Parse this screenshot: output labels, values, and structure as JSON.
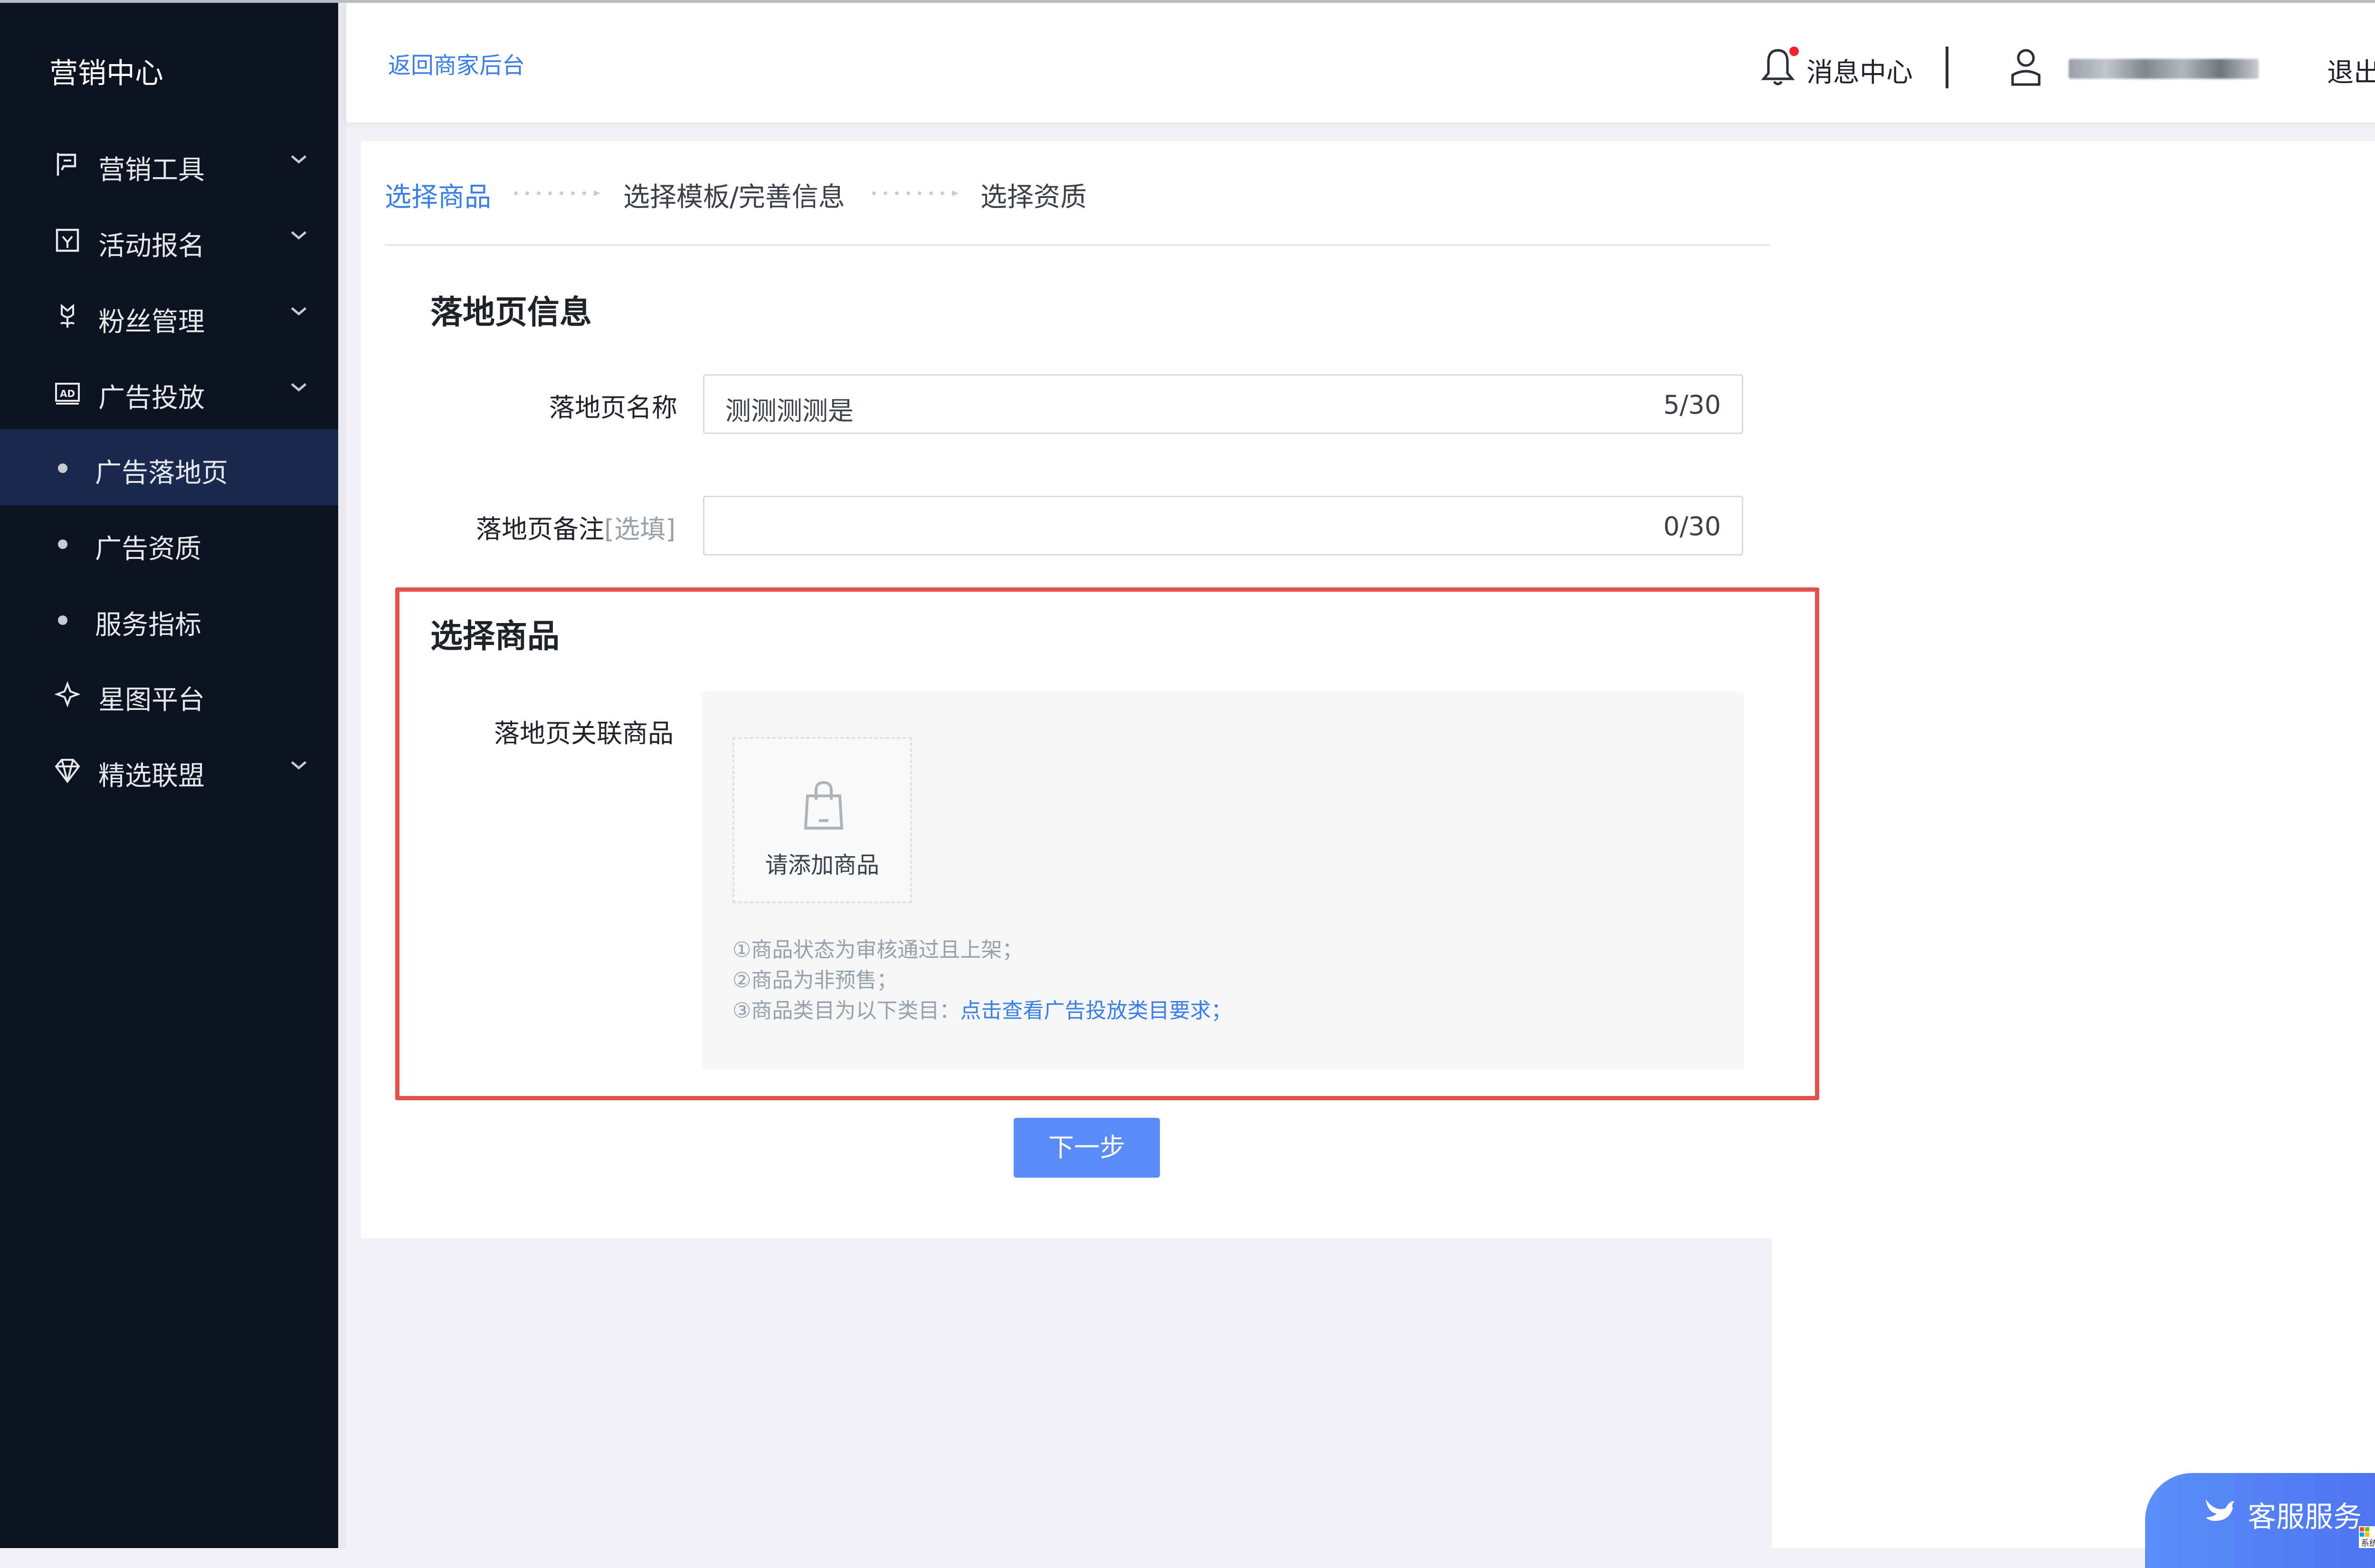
{
  "sidebar": {
    "title": "营销中心",
    "items": [
      {
        "label": "营销工具",
        "icon": "flag-icon"
      },
      {
        "label": "活动报名",
        "icon": "calendar-icon"
      },
      {
        "label": "粉丝管理",
        "icon": "flower-icon"
      },
      {
        "label": "广告投放",
        "icon": "ad-icon"
      },
      {
        "label": "星图平台",
        "icon": "star-icon"
      },
      {
        "label": "精选联盟",
        "icon": "diamond-icon"
      }
    ],
    "sub_items": [
      {
        "label": "广告落地页",
        "active": true
      },
      {
        "label": "广告资质",
        "active": false
      },
      {
        "label": "服务指标",
        "active": false
      }
    ]
  },
  "header": {
    "back_link": "返回商家后台",
    "message_center": "消息中心",
    "logout": "退出"
  },
  "steps": [
    {
      "label": "选择商品",
      "active": true
    },
    {
      "label": "选择模板/完善信息",
      "active": false
    },
    {
      "label": "选择资质",
      "active": false
    }
  ],
  "landing_info": {
    "title": "落地页信息",
    "name_label": "落地页名称",
    "name_value": "测测测测是",
    "name_count": "5/30",
    "remark_label": "落地页备注",
    "remark_optional": "[选填]",
    "remark_value": "",
    "remark_count": "0/30"
  },
  "select_product": {
    "title": "选择商品",
    "related_label": "落地页关联商品",
    "add_label": "请添加商品",
    "rules": [
      "①商品状态为审核通过且上架；",
      "②商品为非预售；",
      "③商品类目为以下类目："
    ],
    "rule_link": "点击查看广告投放类目要求；"
  },
  "next_button": "下一步",
  "service_button": "客服服务",
  "watermark": "系统粉",
  "colors": {
    "accent": "#3a7ee6",
    "button": "#5a8bf6",
    "highlight": "#e0524a",
    "sidebar_bg": "#0c1220",
    "sidebar_active": "#1a2a4f"
  }
}
